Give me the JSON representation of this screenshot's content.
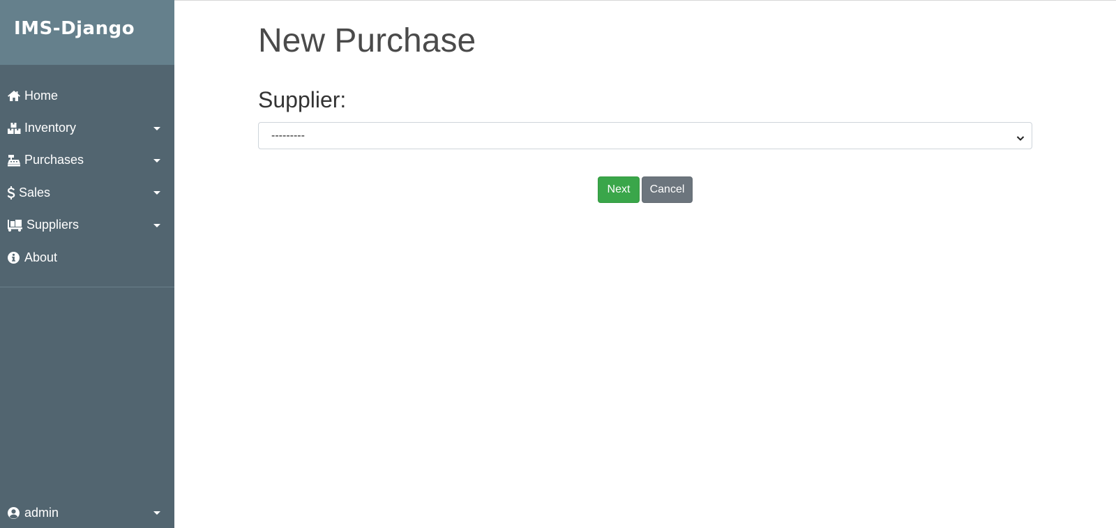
{
  "sidebar": {
    "brand": "IMS-Django",
    "items": [
      {
        "label": "Home",
        "icon": "home-icon",
        "dropdown": false
      },
      {
        "label": "Inventory",
        "icon": "boxes-icon",
        "dropdown": true
      },
      {
        "label": "Purchases",
        "icon": "cash-register-icon",
        "dropdown": true
      },
      {
        "label": "Sales",
        "icon": "dollar-icon",
        "dropdown": true
      },
      {
        "label": "Suppliers",
        "icon": "truck-loading-icon",
        "dropdown": true
      },
      {
        "label": "About",
        "icon": "info-circle-icon",
        "dropdown": false
      }
    ],
    "user": {
      "label": "admin",
      "icon": "user-circle-icon"
    }
  },
  "main": {
    "title": "New Purchase",
    "supplier_label": "Supplier:",
    "supplier_select": {
      "selected": "---------"
    },
    "next_label": "Next",
    "cancel_label": "Cancel"
  },
  "colors": {
    "sidebar_bg": "#526570",
    "brand_bg": "#65808c",
    "next_button": "#3aa64a",
    "cancel_button": "#6c757d"
  }
}
